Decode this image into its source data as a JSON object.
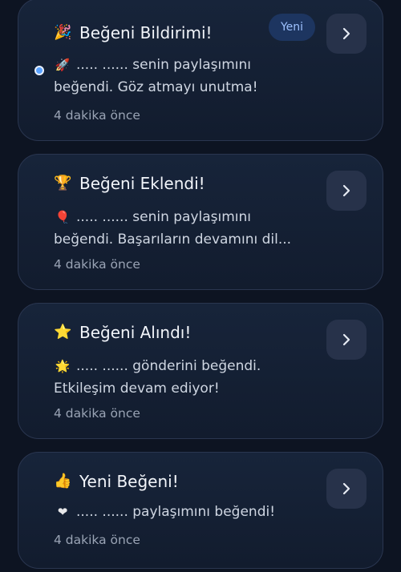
{
  "notifications": [
    {
      "title_emoji": "🎉",
      "title": "Beğeni Bildirimi!",
      "badge": "Yeni",
      "body_emoji": "🚀",
      "body": "..... ...... senin paylaşımını beğendi. Göz atmayı unutma!",
      "time": "4 dakika önce",
      "unread": true
    },
    {
      "title_emoji": "🏆",
      "title": "Beğeni Eklendi!",
      "body_emoji": "🎈",
      "body": "..... ...... senin paylaşımını beğendi. Başarıların devamını dil...",
      "time": "4 dakika önce",
      "unread": false
    },
    {
      "title_emoji": "⭐",
      "title": "Beğeni Alındı!",
      "body_emoji": "🌟",
      "body": "..... ...... gönderini beğendi. Etkileşim devam ediyor!",
      "time": "4 dakika önce",
      "unread": false
    },
    {
      "title_emoji": "👍",
      "title": "Yeni Beğeni!",
      "body_emoji": "❤",
      "body": "..... ...... paylaşımını beğendi!",
      "time": "4 dakika önce",
      "unread": false
    }
  ]
}
